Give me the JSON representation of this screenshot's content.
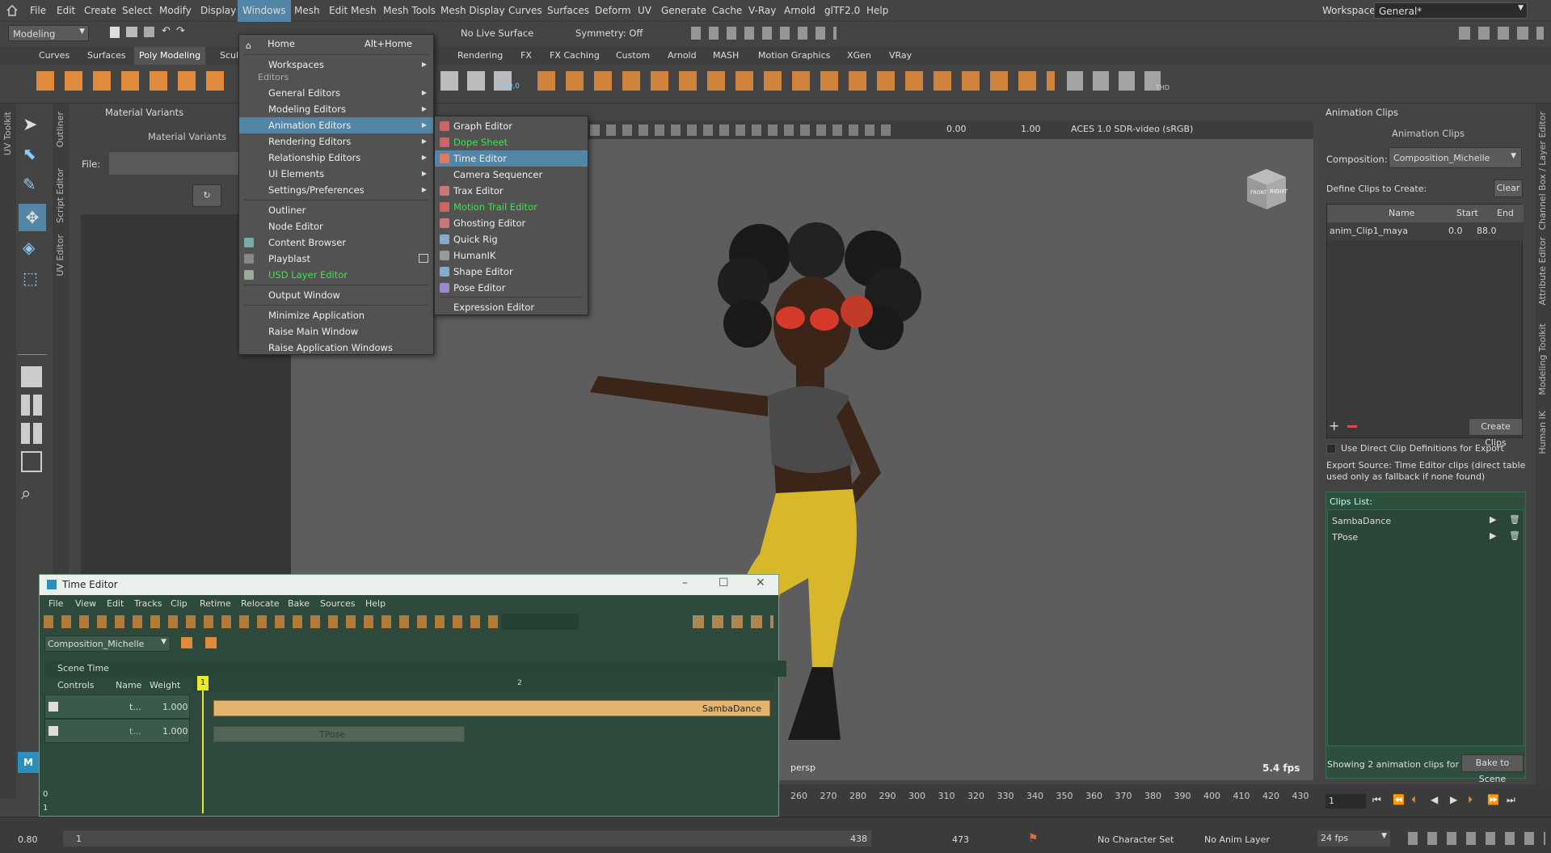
{
  "menubar": {
    "items": [
      "File",
      "Edit",
      "Create",
      "Select",
      "Modify",
      "Display",
      "Windows",
      "Mesh",
      "Edit Mesh",
      "Mesh Tools",
      "Mesh Display",
      "Curves",
      "Surfaces",
      "Deform",
      "UV",
      "Generate",
      "Cache",
      "V-Ray",
      "Arnold",
      "glTF2.0",
      "Help"
    ],
    "workspace_label": "Workspace:",
    "workspace_value": "General*"
  },
  "status_line": {
    "mode": "Modeling",
    "live_surface": "No Live Surface",
    "symmetry": "Symmetry: Off"
  },
  "shelf_tabs": [
    "Curves",
    "Surfaces",
    "Poly Modeling",
    "Sculpting",
    "Rendering",
    "FX",
    "FX Caching",
    "Custom",
    "Arnold",
    "MASH",
    "Motion Graphics",
    "XGen",
    "VRay"
  ],
  "shelf_tabs_visible": [
    "Curves",
    "Surfaces",
    "Poly Modeling",
    "Scul",
    "Rendering",
    "FX",
    "FX Caching",
    "Custom",
    "Arnold",
    "MASH",
    "Motion Graphics",
    "XGen",
    "VRay"
  ],
  "shelf_coord_label": "0,0,0",
  "shelf_thd_label": "THD",
  "left_vtabs": [
    "UV Toolkit",
    "Outliner",
    "Script Editor",
    "UV Editor"
  ],
  "right_vtabs": [
    "Channel Box / Layer Editor",
    "Attribute Editor",
    "Modeling Toolkit",
    "Human IK"
  ],
  "material_panel": {
    "tab": "Material Variants",
    "title": "Material Variants",
    "file_label": "File:"
  },
  "windows_menu": {
    "home": "Home",
    "home_shortcut": "Alt+Home",
    "workspaces": "Workspaces",
    "editors_header": "Editors",
    "items": [
      "General Editors",
      "Modeling Editors",
      "Animation Editors",
      "Rendering Editors",
      "Relationship Editors",
      "UI Elements",
      "Settings/Preferences"
    ],
    "items2": [
      "Outliner",
      "Node Editor",
      "Content Browser",
      "Playblast",
      "USD Layer Editor"
    ],
    "output_window": "Output Window",
    "items3": [
      "Minimize Application",
      "Raise Main Window",
      "Raise Application Windows"
    ]
  },
  "animation_submenu": {
    "items": [
      "Graph Editor",
      "Dope Sheet",
      "Time Editor",
      "Camera Sequencer",
      "Trax Editor",
      "Motion Trail Editor",
      "Ghosting Editor",
      "Quick Rig",
      "HumanIK",
      "Shape Editor",
      "Pose Editor"
    ],
    "expression": "Expression Editor"
  },
  "viewport": {
    "exposure": "0.00",
    "gamma": "1.00",
    "colorspace": "ACES 1.0 SDR-video (sRGB)",
    "camera": "persp",
    "fps": "5.4 fps",
    "cube_front": "FRONT",
    "cube_right": "RIGHT"
  },
  "anim_clips_panel": {
    "tab": "Animation Clips",
    "title": "Animation Clips",
    "composition_label": "Composition:",
    "composition_value": "Composition_Michelle",
    "define_label": "Define Clips to Create:",
    "clear_label": "Clear",
    "table_headers": [
      "Name",
      "Start",
      "End"
    ],
    "table_rows": [
      {
        "name": "anim_Clip1_maya",
        "start": "0.0",
        "end": "88.0"
      }
    ],
    "create_clips": "Create Clips",
    "use_direct": "Use Direct Clip Definitions for Export",
    "export_source": "Export Source: Time Editor clips (direct table used only as fallback if none found)",
    "clips_list_label": "Clips List:",
    "clips": [
      "SambaDance",
      "TPose"
    ],
    "showing": "Showing 2 animation clips for",
    "bake": "Bake to Scene"
  },
  "time_editor": {
    "title": "Time Editor",
    "menu": [
      "File",
      "View",
      "Edit",
      "Tracks",
      "Clip",
      "Retime",
      "Relocate",
      "Bake",
      "Sources",
      "Help"
    ],
    "composition": "Composition_Michelle",
    "scene_time": "Scene Time",
    "headers": [
      "Controls",
      "Name",
      "Weight"
    ],
    "tracks": [
      {
        "name": "t...",
        "weight": "1.000",
        "clip": "SambaDance"
      },
      {
        "name": "t...",
        "weight": "1.000",
        "clip": "TPose"
      }
    ],
    "playhead": "1",
    "ruler_mark": "2",
    "ruler_zero": "0",
    "ruler_one": "1"
  },
  "timeline": {
    "ticks": [
      "260",
      "270",
      "280",
      "290",
      "300",
      "310",
      "320",
      "330",
      "340",
      "350",
      "360",
      "370",
      "380",
      "390",
      "400",
      "410",
      "420",
      "430"
    ],
    "current_frame": "1"
  },
  "range_bar": {
    "start": "0.80",
    "range_start": "1",
    "range_end": "438",
    "end": "473",
    "character_set": "No Character Set",
    "anim_layer": "No Anim Layer",
    "fps": "24 fps"
  }
}
